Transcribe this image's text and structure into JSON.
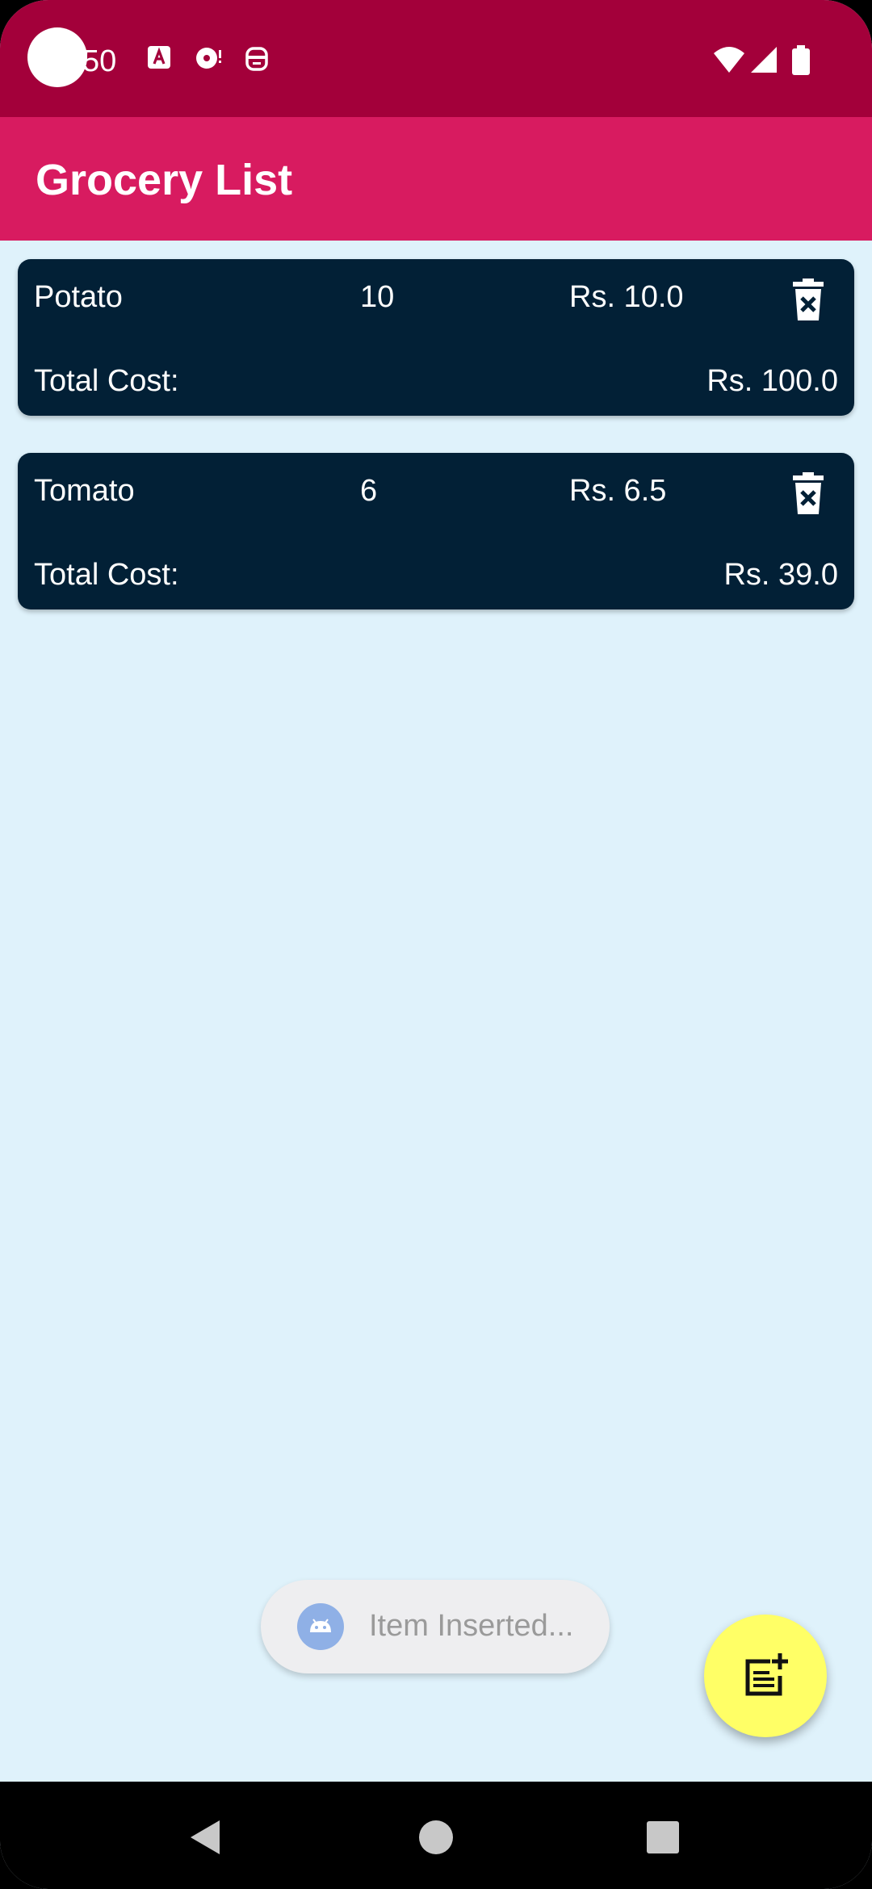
{
  "status_bar": {
    "time": "50",
    "icons": [
      "text-a-icon",
      "podcast-icon",
      "robot-face-icon"
    ],
    "right_icons": [
      "wifi-icon",
      "signal-icon",
      "battery-icon"
    ]
  },
  "app_bar": {
    "title": "Grocery List"
  },
  "items": [
    {
      "name": "Potato",
      "quantity": "10",
      "price": "Rs. 10.0",
      "total_label": "Total Cost:",
      "total_value": "Rs. 100.0"
    },
    {
      "name": "Tomato",
      "quantity": "6",
      "price": "Rs. 6.5",
      "total_label": "Total Cost:",
      "total_value": "Rs. 39.0"
    }
  ],
  "toast": {
    "message": "Item Inserted..."
  },
  "fab": {
    "icon": "add-note-icon"
  },
  "nav_bar": {
    "buttons": [
      "back-icon",
      "home-icon",
      "recents-icon"
    ]
  },
  "colors": {
    "status_bar": "#a3003a",
    "app_bar": "#d81b60",
    "card": "#022036",
    "background": "#dff2fb",
    "fab": "#ffff66"
  }
}
